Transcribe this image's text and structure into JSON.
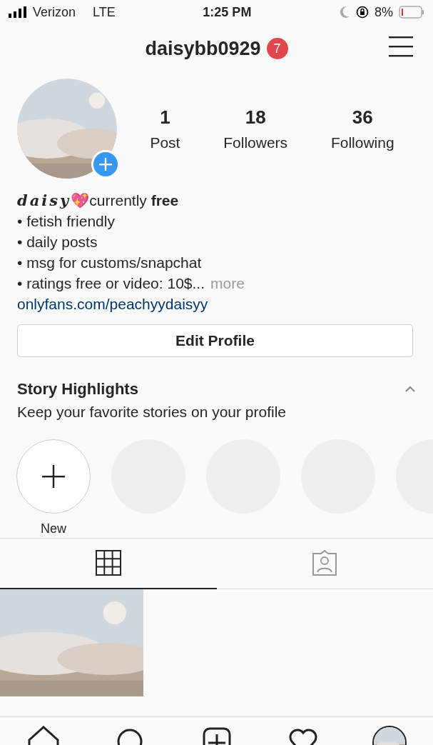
{
  "status_bar": {
    "carrier": "Verizon",
    "network": "LTE",
    "time": "1:25 PM",
    "battery": "8%"
  },
  "header": {
    "username": "daisybb0929",
    "badge": "7"
  },
  "stats": [
    {
      "value": "1",
      "label": "Post"
    },
    {
      "value": "18",
      "label": "Followers"
    },
    {
      "value": "36",
      "label": "Following"
    }
  ],
  "bio": {
    "name": "*daisy*💖currently **free**",
    "lines": [
      "• fetish friendly",
      "• daily posts",
      "• msg for customs/snapchat",
      "• ratings free or video: 10$..."
    ],
    "more": "more",
    "link": "onlyfans.com/peachyydaisyy"
  },
  "edit_button": "Edit Profile",
  "highlights": {
    "title": "Story Highlights",
    "subtitle": "Keep your favorite stories on your profile",
    "expanded": true,
    "items": [
      {
        "kind": "new",
        "label": "New"
      },
      {
        "kind": "empty"
      },
      {
        "kind": "empty"
      },
      {
        "kind": "empty"
      },
      {
        "kind": "empty"
      }
    ]
  },
  "tabs": [
    {
      "kind": "grid",
      "selected": true
    },
    {
      "kind": "tagged",
      "selected": false
    }
  ],
  "nav": [
    {
      "kind": "home"
    },
    {
      "kind": "search"
    },
    {
      "kind": "add"
    },
    {
      "kind": "heart"
    },
    {
      "kind": "profile"
    }
  ]
}
